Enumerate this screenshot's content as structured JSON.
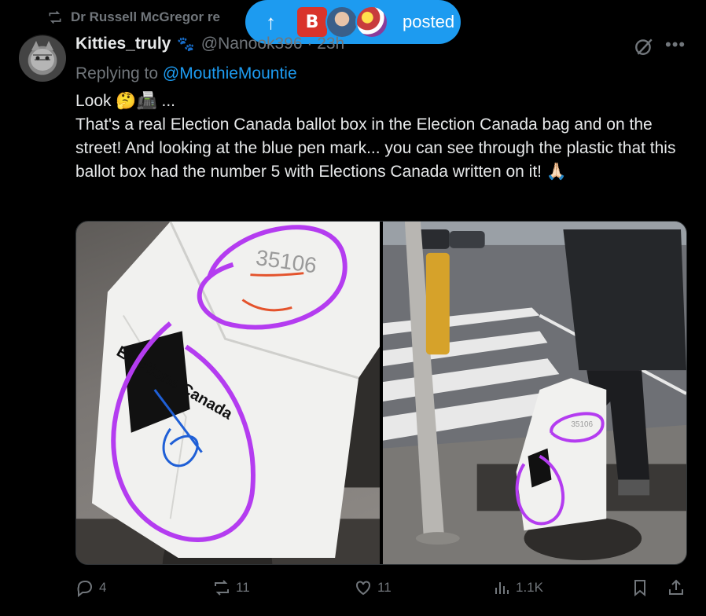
{
  "repost": {
    "label": "Dr Russell McGregor re"
  },
  "pill": {
    "label": "posted",
    "b_letter": "B"
  },
  "tweet": {
    "name": "Kitties_truly",
    "paw": "🐾",
    "handle": "@Nanook396 · 23h",
    "replying_prefix": "Replying to ",
    "replying_to": "@MouthieMountie",
    "line1": "Look 🤔📠 ...",
    "body": "That's a real Election Canada ballot box in the Election Canada bag and on the street! And looking at the blue pen mark... you can see through the plastic that this ballot box had the number 5 with Elections Canada written on it! 🙏🏻"
  },
  "media": {
    "left_bag_number": "35106",
    "left_bag_text": "Elections Canada",
    "right_bag_number": "35106"
  },
  "actions": {
    "replies": "4",
    "reposts": "11",
    "likes": "11",
    "views": "1.1K"
  },
  "colors": {
    "accent": "#1d9bf0",
    "muted": "#71767b",
    "text": "#e7e9ea",
    "annotation_purple": "#b43cf0",
    "annotation_blue": "#1f5fd6",
    "annotation_red": "#e4532c"
  },
  "icons": [
    "repost-icon",
    "arrow-up-icon",
    "grok-icon",
    "more-icon",
    "reply-icon",
    "retweet-icon",
    "like-icon",
    "views-icon",
    "bookmark-icon",
    "share-icon"
  ]
}
